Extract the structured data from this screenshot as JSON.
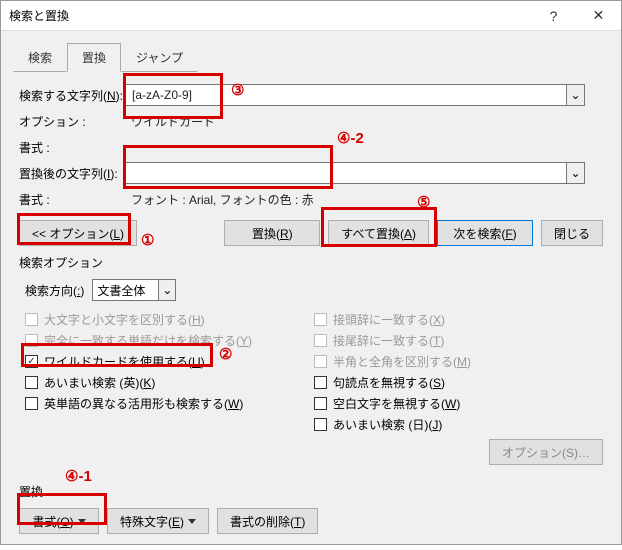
{
  "window": {
    "title": "検索と置換"
  },
  "tabs": {
    "search": "検索",
    "replace": "置換",
    "jump": "ジャンプ"
  },
  "labels": {
    "find_what": "検索する文字列(<u>N</u>):",
    "options": "オプション :",
    "format": "書式 :",
    "replace_with": "置換後の文字列(<u>I</u>):",
    "search_options_heading": "検索オプション",
    "search_direction": "検索方向(<u>:</u>)",
    "replace_group": "置換"
  },
  "values": {
    "find_what": "[a-zA-Z0-9]",
    "options_text": "ワイルドカード",
    "replace_with": "",
    "format_text": "フォント : Arial, フォントの色 : 赤",
    "direction": "文書全体"
  },
  "buttons": {
    "options_toggle": "<< オプション(<u>L</u>)",
    "replace": "置換(<u>R</u>)",
    "replace_all": "すべて置換(<u>A</u>)",
    "find_next": "次を検索(<u>F</u>)",
    "close": "閉じる",
    "format_btn": "書式(<u>O</u>)",
    "special": "特殊文字(<u>E</u>)",
    "no_format": "書式の削除(<u>T</u>)",
    "options_s": "オプション(S)…"
  },
  "checks": {
    "match_case": "大文字と小文字を区別する(<u>H</u>)",
    "whole_word": "完全に一致する単語だけを検索する(<u>Y</u>)",
    "wildcards": "ワイルドカードを使用する(<u>U</u>)",
    "sounds_like": "あいまい検索 (英)(<u>K</u>)",
    "word_forms": "英単語の異なる活用形も検索する(<u>W</u>)",
    "prefix": "接頭辞に一致する(<u>X</u>)",
    "suffix": "接尾辞に一致する(<u>T</u>)",
    "half_full": "半角と全角を区別する(<u>M</u>)",
    "punct": "句読点を無視する(<u>S</u>)",
    "white": "空白文字を無視する(<u>W</u>)",
    "fuzzy_jp": "あいまい検索 (日)(<u>J</u>)"
  },
  "annotations": {
    "a1": "①",
    "a2": "②",
    "a3": "③",
    "a41": "④-1",
    "a42": "④-2",
    "a5": "⑤"
  }
}
